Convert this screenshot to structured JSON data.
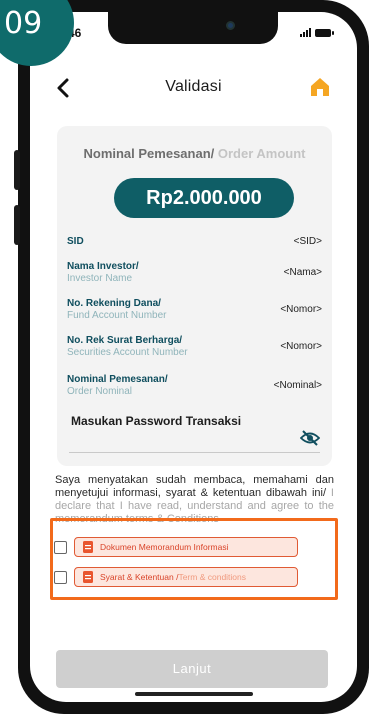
{
  "step_badge": "09",
  "status_bar": {
    "time": "9.46"
  },
  "header": {
    "title": "Validasi",
    "back_icon": "chevron-left-icon",
    "home_icon": "home-icon"
  },
  "order": {
    "title_id": "Nominal Pemesanan/",
    "title_en": " Order Amount",
    "amount": "Rp2.000.000"
  },
  "fields": [
    {
      "label": "SID",
      "sublabel": "",
      "value": "<SID>"
    },
    {
      "label": "Nama Investor/",
      "sublabel": "Investor Name",
      "value": "<Nama>"
    },
    {
      "label": "No. Rekening Dana/",
      "sublabel": "Fund Account Number",
      "value": "<Nomor>"
    },
    {
      "label": "No. Rek Surat Berharga/",
      "sublabel": "Securities Account Number",
      "value": "<Nomor>"
    },
    {
      "label": "Nominal Pemesanan/",
      "sublabel": "Order Nominal",
      "value": "<Nominal>"
    }
  ],
  "password": {
    "label": "Masukan Password Transaksi",
    "value": "",
    "toggle_icon": "eye-off-icon"
  },
  "declaration": {
    "text_id": "Saya menyatakan sudah membaca, memahami dan menyetujui informasi, syarat & ketentuan dibawah ini/",
    "text_en": " I declare that I have read, understand and agree to the memorandum terms & Conditions"
  },
  "documents": [
    {
      "label_id": "Dokumen Memorandum Informasi",
      "label_en": "",
      "icon": "document-icon",
      "checked": false
    },
    {
      "label_id": "Syarat & Ketentuan /",
      "label_en": " Term & conditions",
      "icon": "document-icon",
      "checked": false
    }
  ],
  "submit": {
    "label": "Lanjut"
  },
  "colors": {
    "primary": "#0f5e66",
    "highlight": "#f26a1b",
    "chip_bg": "#fde6de",
    "chip_text": "#d9442a",
    "disabled": "#cfcfcf",
    "home_icon": "#f5a623"
  }
}
